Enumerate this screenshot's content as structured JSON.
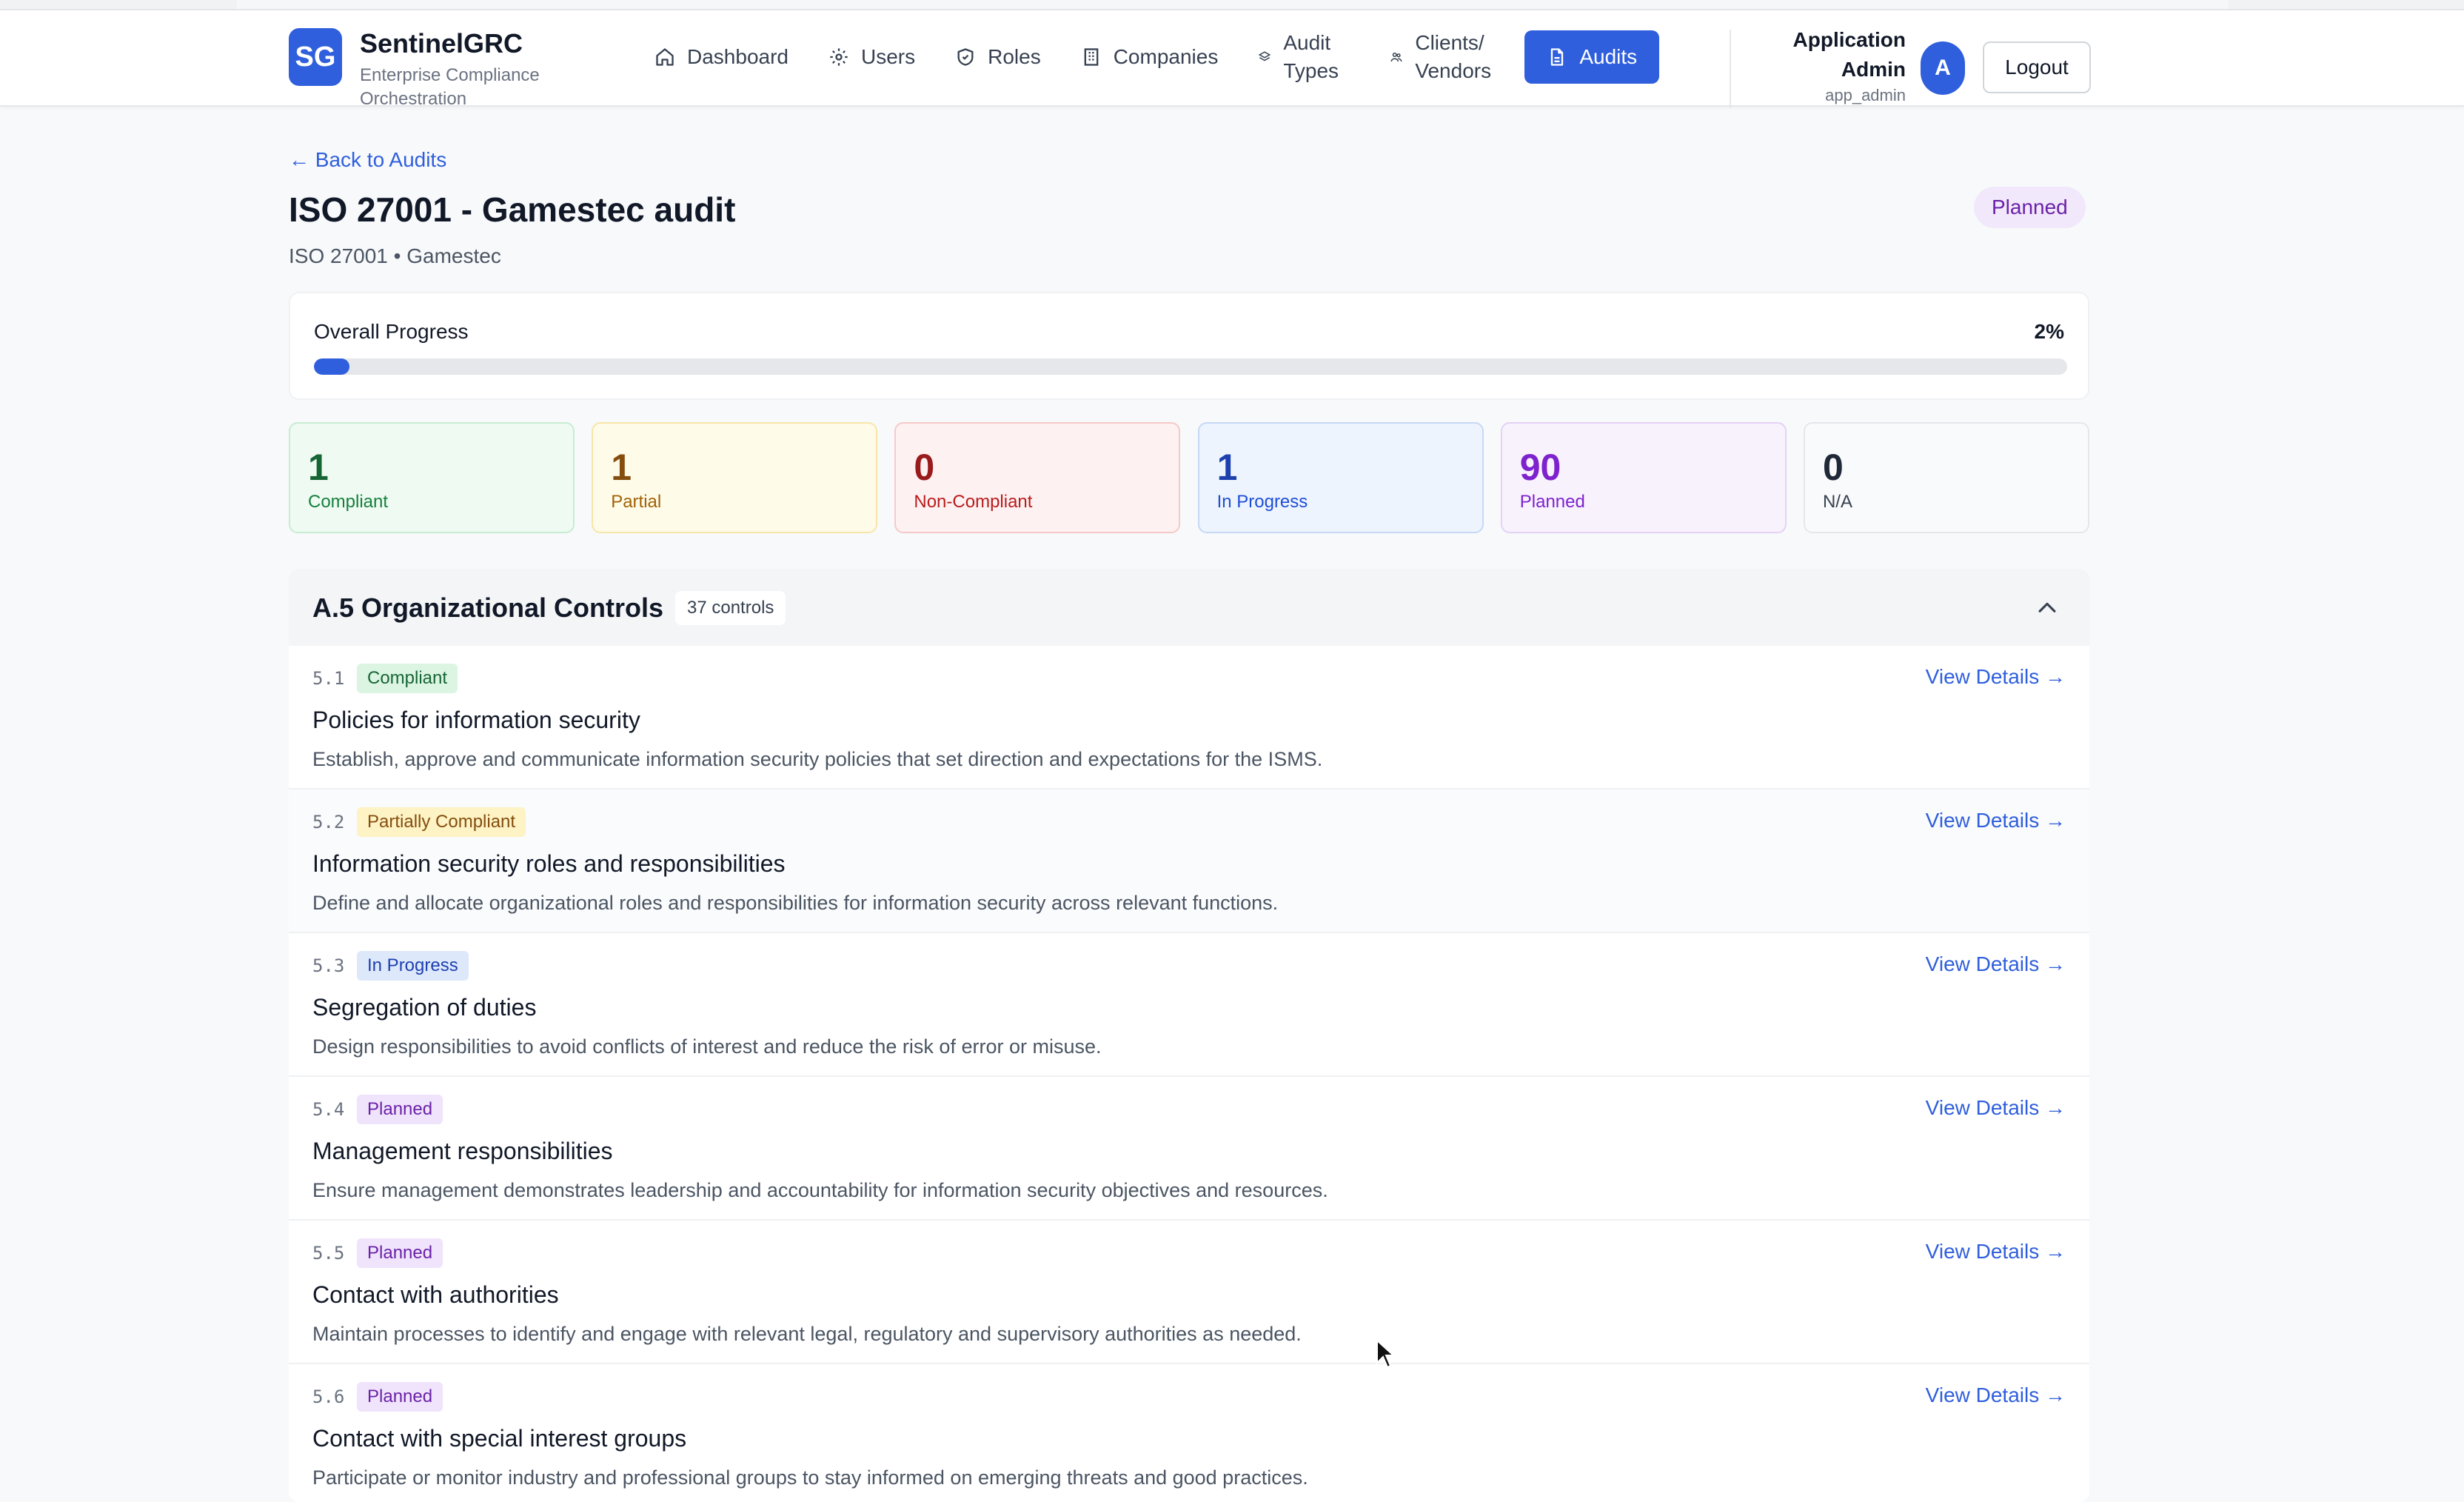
{
  "brand": {
    "logo_text": "SG",
    "name": "SentinelGRC",
    "subtitle": "Enterprise Compliance Orchestration"
  },
  "nav": {
    "items": [
      {
        "label": "Dashboard",
        "icon": "home-icon"
      },
      {
        "label": "Users",
        "icon": "users-icon"
      },
      {
        "label": "Roles",
        "icon": "shield-icon"
      },
      {
        "label": "Companies",
        "icon": "building-icon"
      },
      {
        "label": "Audit Types",
        "icon": "layers-icon"
      },
      {
        "label": "Clients/ Vendors",
        "icon": "people-icon"
      },
      {
        "label": "Audits",
        "icon": "document-icon",
        "active": true
      }
    ]
  },
  "user": {
    "name": "Application Admin",
    "handle": "app_admin",
    "avatar": "A",
    "logout_label": "Logout"
  },
  "page": {
    "back_label": "← Back to Audits",
    "title": "ISO 27001 - Gamestec audit",
    "subtitle": "ISO 27001 • Gamestec",
    "status": "Planned"
  },
  "progress": {
    "label": "Overall Progress",
    "percent_text": "2%",
    "value": 0.02
  },
  "stats": [
    {
      "value": "1",
      "label": "Compliant"
    },
    {
      "value": "1",
      "label": "Partial"
    },
    {
      "value": "0",
      "label": "Non-Compliant"
    },
    {
      "value": "1",
      "label": "In Progress"
    },
    {
      "value": "90",
      "label": "Planned"
    },
    {
      "value": "0",
      "label": "N/A"
    }
  ],
  "section": {
    "title": "A.5 Organizational Controls",
    "count": "37 controls"
  },
  "controls": [
    {
      "num": "5.1",
      "status": "Compliant",
      "title": "Policies for information security",
      "desc": "Establish, approve and communicate information security policies that set direction and expectations for the ISMS.",
      "link": "View Details →"
    },
    {
      "num": "5.2",
      "status": "Partially Compliant",
      "title": "Information security roles and responsibilities",
      "desc": "Define and allocate organizational roles and responsibilities for information security across relevant functions.",
      "link": "View Details →"
    },
    {
      "num": "5.3",
      "status": "In Progress",
      "title": "Segregation of duties",
      "desc": "Design responsibilities to avoid conflicts of interest and reduce the risk of error or misuse.",
      "link": "View Details →"
    },
    {
      "num": "5.4",
      "status": "Planned",
      "title": "Management responsibilities",
      "desc": "Ensure management demonstrates leadership and accountability for information security objectives and resources.",
      "link": "View Details →"
    },
    {
      "num": "5.5",
      "status": "Planned",
      "title": "Contact with authorities",
      "desc": "Maintain processes to identify and engage with relevant legal, regulatory and supervisory authorities as needed.",
      "link": "View Details →"
    },
    {
      "num": "5.6",
      "status": "Planned",
      "title": "Contact with special interest groups",
      "desc": "Participate or monitor industry and professional groups to stay informed on emerging threats and good practices.",
      "link": "View Details →"
    }
  ],
  "colors": {
    "accent": "#2f5fdc",
    "compliant": "#166534",
    "partial": "#854d0e",
    "non_compliant": "#991b1b",
    "in_progress": "#1e40af",
    "planned": "#6b21a8"
  }
}
